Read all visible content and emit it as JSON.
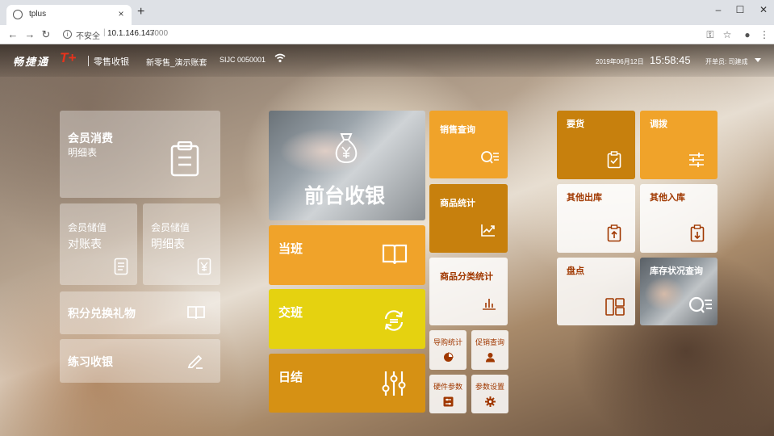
{
  "browser": {
    "tab_title": "tplus",
    "tab_close": "×",
    "new_tab": "+",
    "minimize": "–",
    "maximize": "☐",
    "close": "✕",
    "back": "←",
    "forward": "→",
    "reload": "↻",
    "info_icon": "i",
    "insecure_label": "不安全",
    "url_sep": "|",
    "url_host": "10.1.146.147",
    "url_port": ":3000",
    "key_icon": "⚿",
    "star_icon": "☆",
    "account_icon": "●",
    "menu_icon": "⋮"
  },
  "header": {
    "brand": "畅捷通",
    "brand_mark": "T+",
    "module": "零售收银",
    "account": "新零售_演示账套",
    "store": "SIJC  0050001",
    "date": "2019年06月12日",
    "time": "15:58:45",
    "operator": "开单员: 司建成"
  },
  "tiles": {
    "member_consume_title": "会员消费",
    "member_consume_sub": "明细表",
    "member_store_a_title": "会员储值",
    "member_store_a_sub": "对账表",
    "member_store_b_title": "会员储值",
    "member_store_b_sub": "明细表",
    "points_redeem": "积分兑换礼物",
    "practice_pos": "练习收银",
    "front_pos": "前台收银",
    "on_duty": "当班",
    "shift_change": "交班",
    "daily_close": "日结",
    "sales_query": "销售查询",
    "product_stats": "商品统计",
    "category_stats": "商品分类统计",
    "guide_stats": "导购统计",
    "promo_query": "促销查询",
    "hw_params": "硬件参数",
    "param_settings": "参数设置",
    "requisition": "要货",
    "transfer": "调拨",
    "other_out": "其他出库",
    "other_in": "其他入库",
    "stocktake": "盘点",
    "stock_status": "库存状况查询"
  },
  "colors": {
    "orange": "#f0a32a",
    "dark_orange": "#c7800d",
    "yellow": "#e5d210",
    "gold": "#d69114",
    "dark_text": "#a03800",
    "brand_red": "#e8331c"
  }
}
